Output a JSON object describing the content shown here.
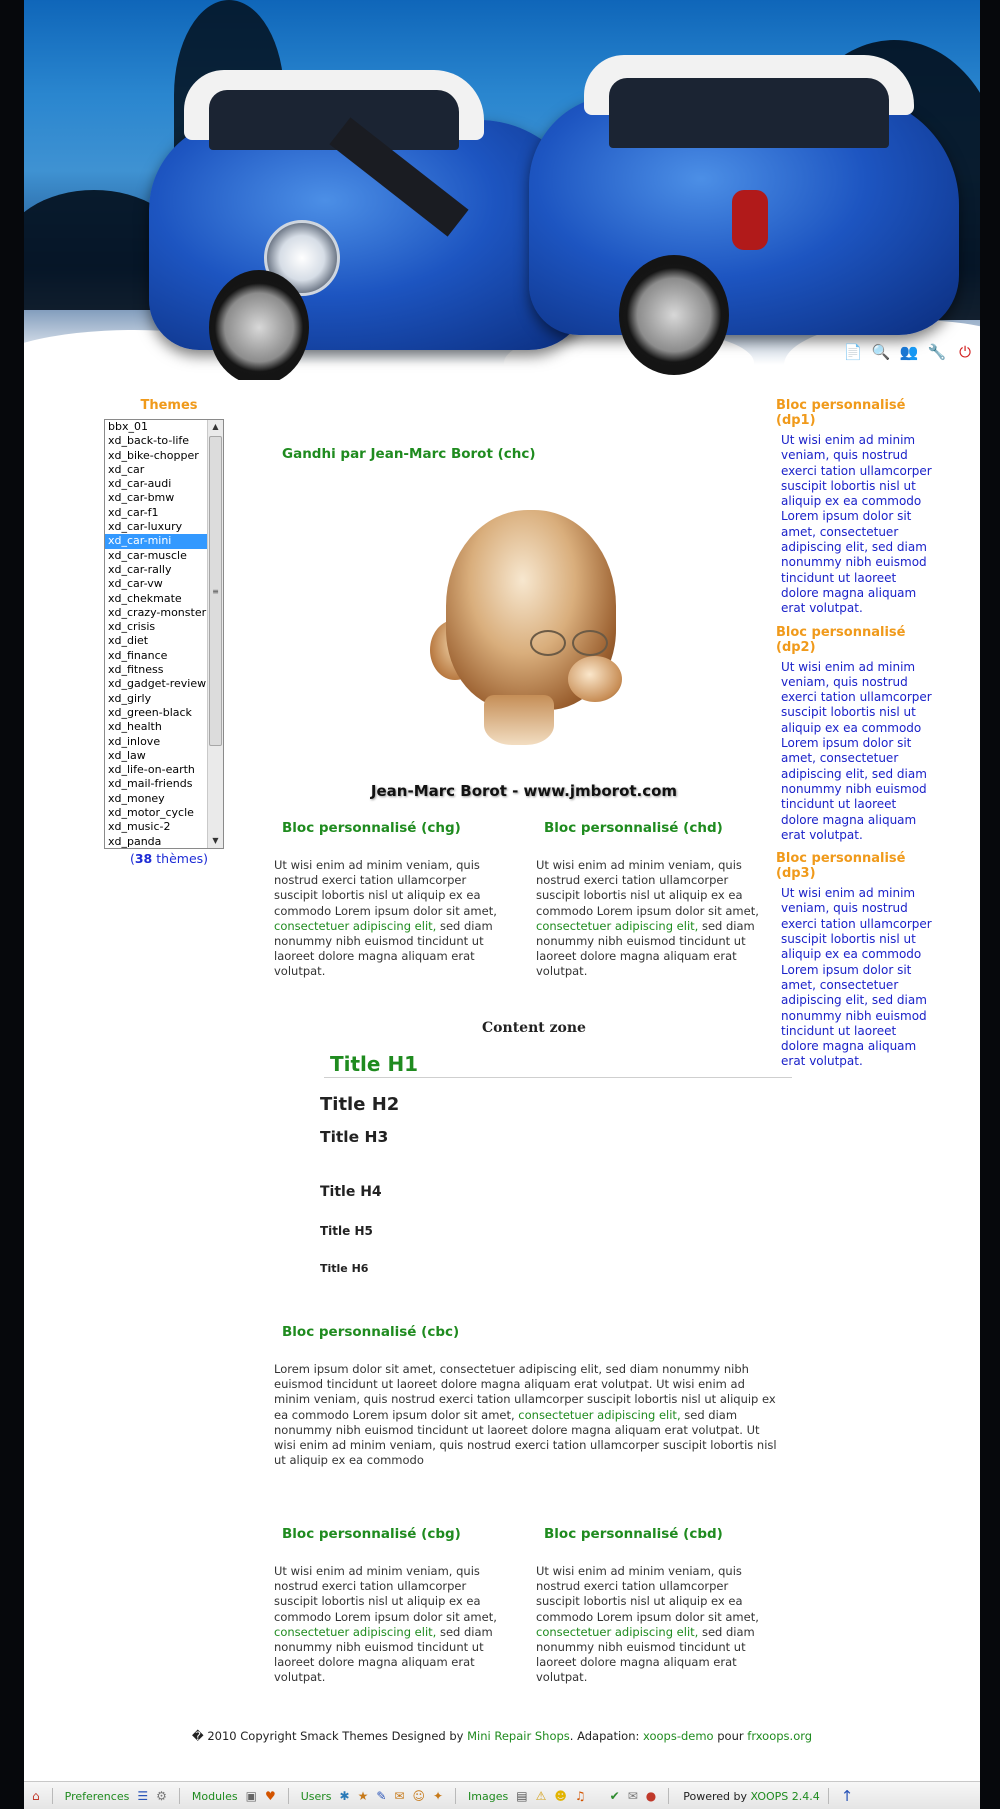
{
  "toolbar_icons": [
    "document-icon",
    "search-icon",
    "users-icon",
    "tools-icon",
    "power-icon"
  ],
  "themes_block": {
    "title": "Themes",
    "items": [
      "bbx_01",
      "xd_back-to-life",
      "xd_bike-chopper",
      "xd_car",
      "xd_car-audi",
      "xd_car-bmw",
      "xd_car-f1",
      "xd_car-luxury",
      "xd_car-mini",
      "xd_car-muscle",
      "xd_car-rally",
      "xd_car-vw",
      "xd_chekmate",
      "xd_crazy-monster",
      "xd_crisis",
      "xd_diet",
      "xd_finance",
      "xd_fitness",
      "xd_gadget-review",
      "xd_girly",
      "xd_green-black",
      "xd_health",
      "xd_inlove",
      "xd_law",
      "xd_life-on-earth",
      "xd_mail-friends",
      "xd_money",
      "xd_motor_cycle",
      "xd_music-2",
      "xd_panda"
    ],
    "selected": "xd_car-mini",
    "count_open": "(",
    "count": "38",
    "count_label": "thèmes)"
  },
  "center": {
    "chc_title": "Gandhi par Jean-Marc Borot (chc)",
    "image_caption": "Jean-Marc Borot - www.jmborot.com",
    "chg": {
      "title": "Bloc personnalisé (chg)",
      "text_a": "Ut wisi enim ad minim veniam, quis nostrud exerci tation ullamcorper suscipit lobortis nisl ut aliquip ex ea commodo Lorem ipsum dolor sit amet, ",
      "link": "consectetuer adipiscing elit,",
      "text_b": " sed diam nonummy nibh euismod tincidunt ut laoreet dolore magna aliquam erat volutpat."
    },
    "chd": {
      "title": "Bloc personnalisé (chd)",
      "text_a": "Ut wisi enim ad minim veniam, quis nostrud exerci tation ullamcorper suscipit lobortis nisl ut aliquip ex ea commodo Lorem ipsum dolor sit amet, ",
      "link": "consectetuer adipiscing elit,",
      "text_b": " sed diam nonummy nibh euismod tincidunt ut laoreet dolore magna aliquam erat volutpat."
    },
    "content_zone": "Content zone",
    "h1": "Title H1",
    "h2": "Title H2",
    "h3": "Title H3",
    "h4": "Title H4",
    "h5": "Title H5",
    "h6": "Title H6",
    "cbc": {
      "title": "Bloc personnalisé (cbc)",
      "text_a": "Lorem ipsum dolor sit amet, consectetuer adipiscing elit, sed diam nonummy nibh euismod tincidunt ut laoreet dolore magna aliquam erat volutpat. Ut wisi enim ad minim veniam, quis nostrud exerci tation ullamcorper suscipit lobortis nisl ut aliquip ex ea commodo Lorem ipsum dolor sit amet, ",
      "link": "consectetuer adipiscing elit,",
      "text_b": " sed diam nonummy nibh euismod tincidunt ut laoreet dolore magna aliquam erat volutpat. Ut wisi enim ad minim veniam, quis nostrud exerci tation ullamcorper suscipit lobortis nisl ut aliquip ex ea commodo"
    },
    "cbg": {
      "title": "Bloc personnalisé (cbg)",
      "text_a": "Ut wisi enim ad minim veniam, quis nostrud exerci tation ullamcorper suscipit lobortis nisl ut aliquip ex ea commodo Lorem ipsum dolor sit amet, ",
      "link": "consectetuer adipiscing elit,",
      "text_b": " sed diam nonummy nibh euismod tincidunt ut laoreet dolore magna aliquam erat volutpat."
    },
    "cbd": {
      "title": "Bloc personnalisé (cbd)",
      "text_a": "Ut wisi enim ad minim veniam, quis nostrud exerci tation ullamcorper suscipit lobortis nisl ut aliquip ex ea commodo Lorem ipsum dolor sit amet, ",
      "link": "consectetuer adipiscing elit,",
      "text_b": " sed diam nonummy nibh euismod tincidunt ut laoreet dolore magna aliquam erat volutpat."
    }
  },
  "right": {
    "dp1": {
      "title": "Bloc personnalisé (dp1)",
      "text": "Ut wisi enim ad minim veniam, quis nostrud exerci tation ullamcorper suscipit lobortis nisl ut aliquip ex ea commodo Lorem ipsum dolor sit amet, consectetuer adipiscing elit, sed diam nonummy nibh euismod tincidunt ut laoreet dolore magna aliquam erat volutpat."
    },
    "dp2": {
      "title": "Bloc personnalisé (dp2)",
      "text": "Ut wisi enim ad minim veniam, quis nostrud exerci tation ullamcorper suscipit lobortis nisl ut aliquip ex ea commodo Lorem ipsum dolor sit amet, consectetuer adipiscing elit, sed diam nonummy nibh euismod tincidunt ut laoreet dolore magna aliquam erat volutpat."
    },
    "dp3": {
      "title": "Bloc personnalisé (dp3)",
      "text": "Ut wisi enim ad minim veniam, quis nostrud exerci tation ullamcorper suscipit lobortis nisl ut aliquip ex ea commodo Lorem ipsum dolor sit amet, consectetuer adipiscing elit, sed diam nonummy nibh euismod tincidunt ut laoreet dolore magna aliquam erat volutpat."
    }
  },
  "footer": {
    "prefix": "� 2010 Copyright Smack Themes Designed by ",
    "designer": "Mini Repair Shops",
    "middle": ". Adapation: ",
    "adapter": "xoops-demo",
    "pour": " pour ",
    "site": "frxoops.org"
  },
  "bottom_bar": {
    "preferences": "Preferences",
    "modules": "Modules",
    "users": "Users",
    "images": "Images",
    "powered_prefix": "Powered by ",
    "powered_name": "XOOPS 2.4.4"
  },
  "colors": {
    "block_title_green": "#1f8b1f",
    "side_title_orange": "#f09a1b",
    "right_text_blue": "#1b22c9"
  }
}
